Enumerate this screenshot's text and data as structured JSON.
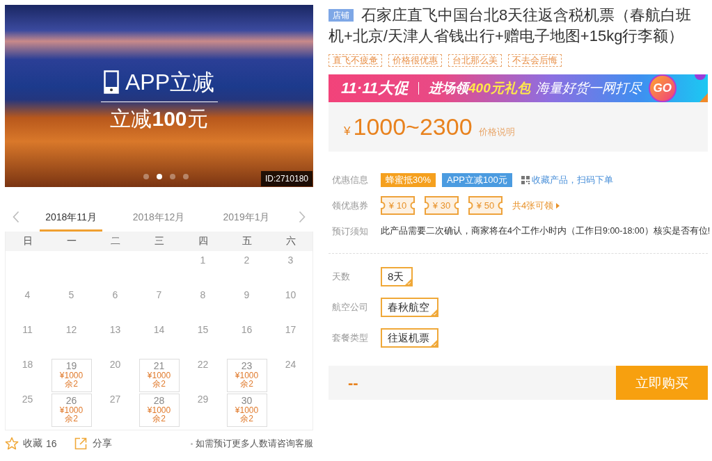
{
  "gallery": {
    "overlay_title": "APP立减",
    "overlay_subtitle": "立减**100**元",
    "dots": [
      {
        "selected": false
      },
      {
        "selected": true
      },
      {
        "selected": false
      },
      {
        "selected": false
      }
    ],
    "id_label": "ID:2710180"
  },
  "calendar": {
    "months": [
      {
        "label": "2018年11月",
        "selected": true
      },
      {
        "label": "2018年12月",
        "selected": false
      },
      {
        "label": "2019年1月",
        "selected": false
      }
    ],
    "weekdays": [
      "日",
      "一",
      "二",
      "三",
      "四",
      "五",
      "六"
    ],
    "weeks": [
      [
        {
          "day": "1",
          "kind": "plain"
        },
        {
          "day": "2",
          "kind": "plain"
        },
        {
          "day": "3",
          "kind": "plain"
        }
      ],
      [
        {
          "day": "4",
          "kind": "plain"
        },
        {
          "day": "5",
          "kind": "plain"
        },
        {
          "day": "6",
          "kind": "plain"
        },
        {
          "day": "7",
          "kind": "plain"
        },
        {
          "day": "8",
          "kind": "plain"
        },
        {
          "day": "9",
          "kind": "plain"
        },
        {
          "day": "10",
          "kind": "plain"
        }
      ],
      [
        {
          "day": "11",
          "kind": "plain"
        },
        {
          "day": "12",
          "kind": "plain"
        },
        {
          "day": "13",
          "kind": "plain"
        },
        {
          "day": "14",
          "kind": "plain"
        },
        {
          "day": "15",
          "kind": "plain"
        },
        {
          "day": "16",
          "kind": "plain"
        },
        {
          "day": "17",
          "kind": "plain"
        }
      ],
      [
        {
          "day": "18",
          "kind": "plain"
        },
        {
          "day": "19",
          "kind": "available",
          "price": "¥1000",
          "remain": "余2"
        },
        {
          "day": "20",
          "kind": "plain"
        },
        {
          "day": "21",
          "kind": "available",
          "price": "¥1000",
          "remain": "余2"
        },
        {
          "day": "22",
          "kind": "plain"
        },
        {
          "day": "23",
          "kind": "available",
          "price": "¥1000",
          "remain": "余2"
        },
        {
          "day": "24",
          "kind": "plain"
        }
      ],
      [
        {
          "day": "25",
          "kind": "plain"
        },
        {
          "day": "26",
          "kind": "available",
          "price": "¥1000",
          "remain": "余2"
        },
        {
          "day": "27",
          "kind": "plain"
        },
        {
          "day": "28",
          "kind": "available",
          "price": "¥1000",
          "remain": "余2"
        },
        {
          "day": "29",
          "kind": "plain"
        },
        {
          "day": "30",
          "kind": "available",
          "price": "¥1000",
          "remain": "余2"
        }
      ]
    ]
  },
  "footer": {
    "favorite_label": "收藏",
    "favorite_count": "16",
    "share_label": "分享",
    "note": "如需预订更多人数请咨询客服"
  },
  "product": {
    "shop_badge": "店铺",
    "title": "石家庄直飞中国台北8天往返含税机票（春航白班机+北京/天津人省钱出行+赠电子地图+15kg行李额）",
    "tags": [
      "直飞不疲惫",
      "价格很优惠",
      "台北那么美",
      "不去会后悔"
    ]
  },
  "promo_banner": {
    "logo": "11·11大促",
    "text": "进场领**400元礼包**",
    "slogan": "海量好货一网打尽",
    "button": "GO"
  },
  "price": {
    "currency": "¥",
    "range": "1000~2300",
    "note": "价格说明"
  },
  "discounts": {
    "label": "优惠信息",
    "badges": [
      {
        "text": "蜂蜜抵30%",
        "color": "#f5a01e"
      },
      {
        "text": "APP立减100元",
        "color": "#4b9be0"
      }
    ],
    "link": "收藏产品，扫码下单"
  },
  "coupons": {
    "label": "领优惠券",
    "items": [
      "¥ 10",
      "¥ 30",
      "¥ 50"
    ],
    "more": "共4张可领"
  },
  "notice": {
    "label": "预订须知",
    "text": "此产品需要二次确认，商家将在4个工作小时内（工作日9:00-18:00）核实是否有位!"
  },
  "options": [
    {
      "label": "天数",
      "choices": [
        {
          "text": "8天",
          "selected": true
        }
      ]
    },
    {
      "label": "航空公司",
      "choices": [
        {
          "text": "春秋航空",
          "selected": true
        }
      ]
    },
    {
      "label": "套餐类型",
      "choices": [
        {
          "text": "往返机票",
          "selected": true
        }
      ]
    }
  ],
  "buy_bar": {
    "price": "--",
    "button": "立即购买"
  }
}
